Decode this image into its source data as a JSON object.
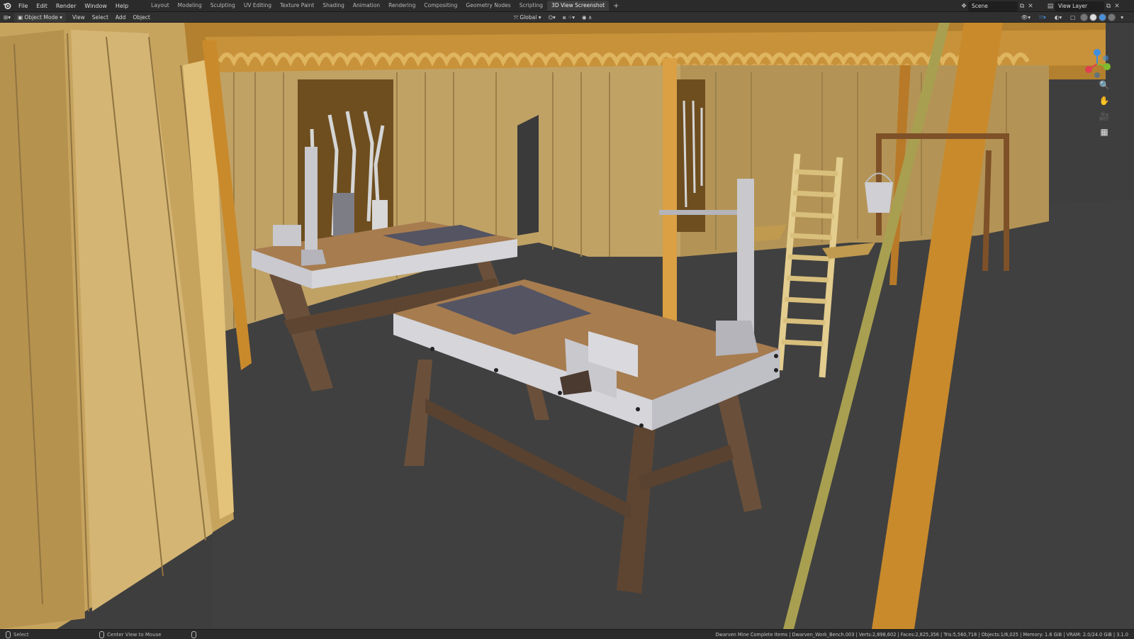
{
  "menu": {
    "items": [
      "File",
      "Edit",
      "Render",
      "Window",
      "Help"
    ]
  },
  "workspaces": {
    "tabs": [
      "Layout",
      "Modeling",
      "Sculpting",
      "UV Editing",
      "Texture Paint",
      "Shading",
      "Animation",
      "Rendering",
      "Compositing",
      "Geometry Nodes",
      "Scripting",
      "3D View Screenshot"
    ],
    "active": "3D View Screenshot",
    "add_label": "+"
  },
  "scene": {
    "label": "Scene"
  },
  "view_layer": {
    "label": "View Layer"
  },
  "header": {
    "mode": "Object Mode",
    "menus": [
      "View",
      "Select",
      "Add",
      "Object"
    ],
    "transform_orientation": "Global"
  },
  "status": {
    "left_action": "Select",
    "mid_action": "Center View to Mouse",
    "info": "Dwarven Mine Complete Items | Dwarven_Work_Bench.003 | Verts:2,898,602 | Faces:2,825,356 | Tris:5,560,718 | Objects:1/6,025 | Memory: 1.6 GiB | VRAM: 2.0/24.0 GiB | 3.1.0"
  },
  "gizmo": {
    "axes": [
      "X",
      "Y",
      "Z"
    ],
    "colors": {
      "x": "#e0404f",
      "y": "#7bbd2f",
      "z": "#3f8fe0"
    }
  },
  "icons": [
    "blender-logo",
    "editor-type-icon",
    "object-mode-icon",
    "pivot-icon",
    "snap-icon",
    "proportional-icon",
    "zoom-icon",
    "pan-hand-icon",
    "camera-icon",
    "grid-icon",
    "mouse-icon"
  ]
}
